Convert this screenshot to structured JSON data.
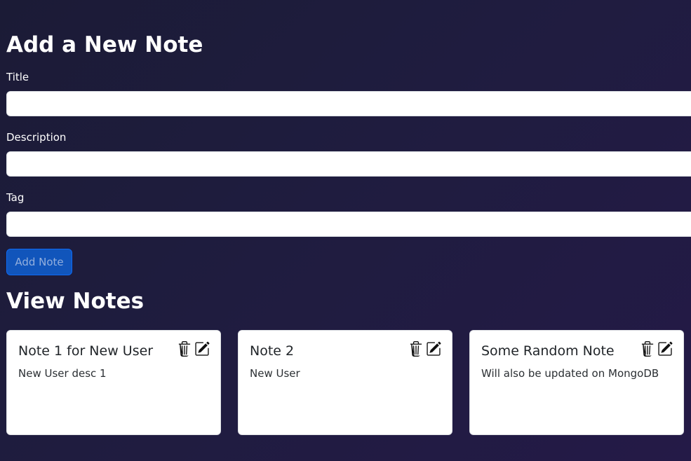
{
  "add_section": {
    "heading": "Add a New Note",
    "fields": {
      "title": {
        "label": "Title",
        "value": "",
        "placeholder": ""
      },
      "description": {
        "label": "Description",
        "value": "",
        "placeholder": ""
      },
      "tag": {
        "label": "Tag",
        "value": "",
        "placeholder": ""
      }
    },
    "submit_label": "Add Note"
  },
  "view_section": {
    "heading": "View Notes",
    "notes": [
      {
        "title": "Note 1 for New User",
        "description": "New User desc 1",
        "icons": [
          "trash-icon",
          "edit-icon"
        ]
      },
      {
        "title": "Note 2",
        "description": "New User",
        "icons": [
          "trash-icon",
          "edit-icon"
        ]
      },
      {
        "title": "Some Random Note",
        "description": "Will also be updated on MongoDB",
        "icons": [
          "trash-icon",
          "edit-icon"
        ]
      }
    ]
  },
  "colors": {
    "background": "#1e1b3d",
    "button": "#1159c2",
    "button_text": "#9ab7e6",
    "card": "#ffffff"
  }
}
